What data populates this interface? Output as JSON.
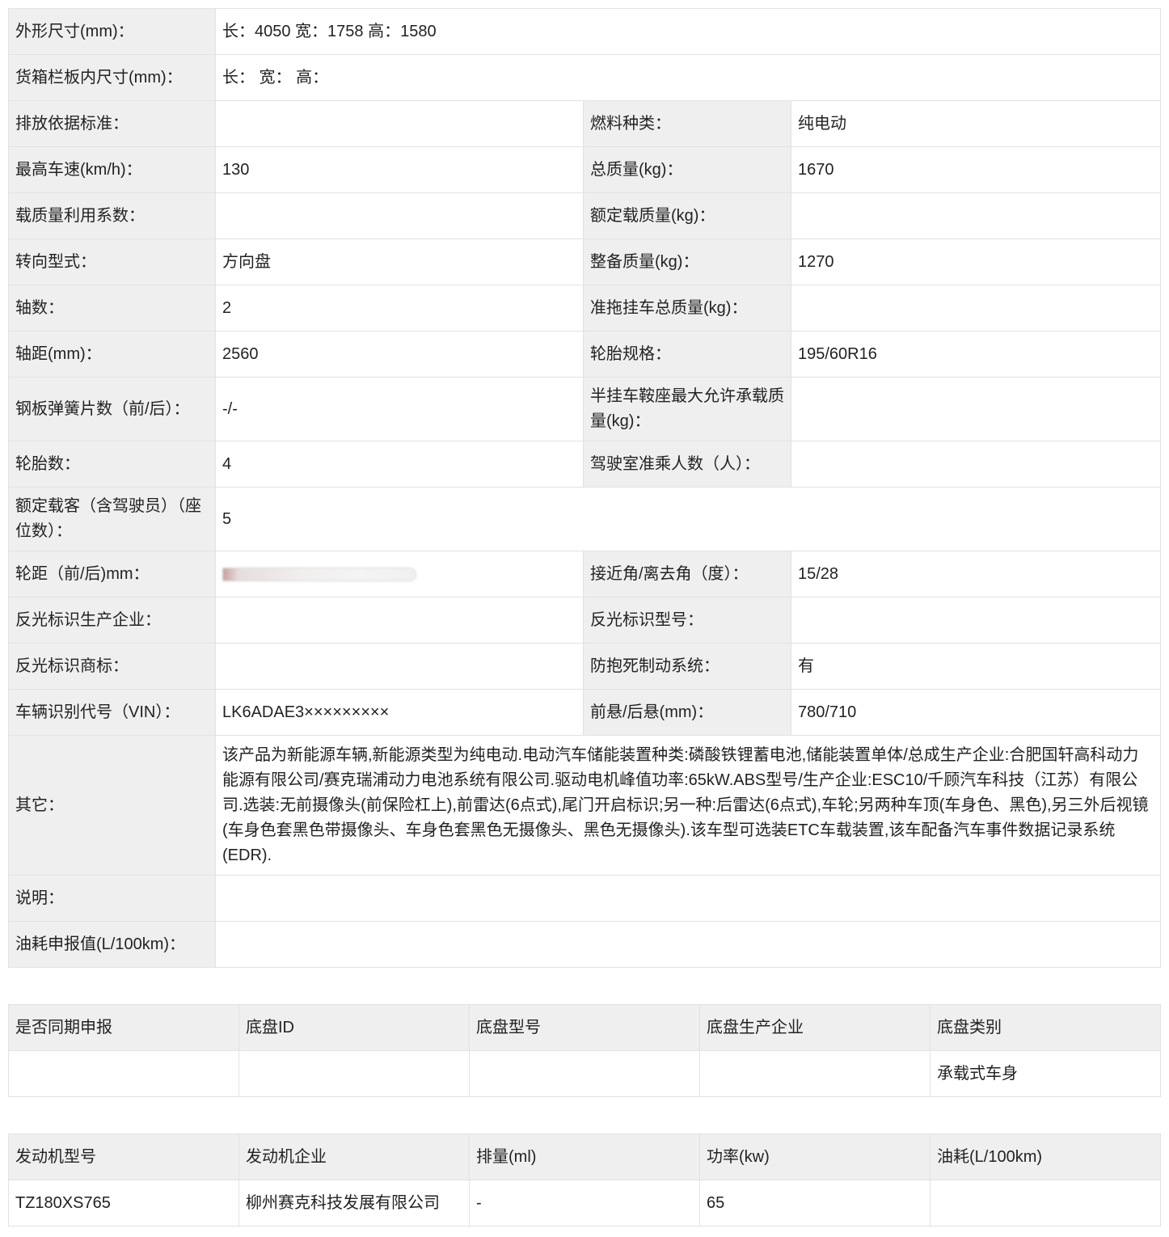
{
  "spec": {
    "dimensions_label": "外形尺寸(mm)：",
    "dimensions_value": "长：4050 宽：1758 高：1580",
    "cargo_box_label": "货箱栏板内尺寸(mm)：",
    "cargo_box_value": "长：  宽：  高：",
    "emission_label": "排放依据标准：",
    "emission_value": "",
    "fuel_label": "燃料种类：",
    "fuel_value": "纯电动",
    "max_speed_label": "最高车速(km/h)：",
    "max_speed_value": "130",
    "total_mass_label": "总质量(kg)：",
    "total_mass_value": "1670",
    "load_util_label": "载质量利用系数：",
    "load_util_value": "",
    "rated_load_label": "额定载质量(kg)：",
    "rated_load_value": "",
    "steering_label": "转向型式：",
    "steering_value": "方向盘",
    "curb_mass_label": "整备质量(kg)：",
    "curb_mass_value": "1270",
    "axles_label": "轴数：",
    "axles_value": "2",
    "trailer_mass_label": "准拖挂车总质量(kg)：",
    "trailer_mass_value": "",
    "wheelbase_label": "轴距(mm)：",
    "wheelbase_value": "2560",
    "tire_spec_label": "轮胎规格：",
    "tire_spec_value": "195/60R16",
    "leaf_spring_label": "钢板弹簧片数（前/后）：",
    "leaf_spring_value": "-/-",
    "saddle_label": "半挂车鞍座最大允许承载质量(kg)：",
    "saddle_value": "",
    "tires_count_label": "轮胎数：",
    "tires_count_value": "4",
    "cab_seats_label": "驾驶室准乘人数（人）：",
    "cab_seats_value": "",
    "passengers_label": "额定载客（含驾驶员）（座位数）：",
    "passengers_value": "5",
    "track_label": "轮距（前/后)mm：",
    "approach_label": "接近角/离去角（度）：",
    "approach_value": "15/28",
    "reflector_maker_label": "反光标识生产企业：",
    "reflector_maker_value": "",
    "reflector_model_label": "反光标识型号：",
    "reflector_model_value": "",
    "reflector_brand_label": "反光标识商标：",
    "reflector_brand_value": "",
    "abs_label": "防抱死制动系统：",
    "abs_value": "有",
    "vin_label": "车辆识别代号（VIN）：",
    "vin_value": "LK6ADAE3×××××××××",
    "overhang_label": "前悬/后悬(mm)：",
    "overhang_value": "780/710",
    "other_label": "其它：",
    "other_value": "该产品为新能源车辆,新能源类型为纯电动.电动汽车储能装置种类:磷酸铁锂蓄电池,储能装置单体/总成生产企业:合肥国轩高科动力能源有限公司/赛克瑞浦动力电池系统有限公司.驱动电机峰值功率:65kW.ABS型号/生产企业:ESC10/千顾汽车科技（江苏）有限公司.选装:无前摄像头(前保险杠上),前雷达(6点式),尾门开启标识;另一种:后雷达(6点式),车轮;另两种车顶(车身色、黑色),另三外后视镜(车身色套黑色带摄像头、车身色套黑色无摄像头、黑色无摄像头).该车型可选装ETC车载装置,该车配备汽车事件数据记录系统(EDR).",
    "note_label": "说明：",
    "note_value": "",
    "fuel_consumption_label": "油耗申报值(L/100km)：",
    "fuel_consumption_value": ""
  },
  "chassis": {
    "headers": [
      "是否同期申报",
      "底盘ID",
      "底盘型号",
      "底盘生产企业",
      "底盘类别"
    ],
    "row": [
      "",
      "",
      "",
      "",
      "承载式车身"
    ]
  },
  "engine": {
    "headers": [
      "发动机型号",
      "发动机企业",
      "排量(ml)",
      "功率(kw)",
      "油耗(L/100km)"
    ],
    "row": [
      "TZ180XS765",
      "柳州赛克科技发展有限公司",
      "-",
      "65",
      ""
    ]
  },
  "colors": {
    "label_background": "#efefef",
    "value_background": "#ffffff",
    "border": "#e2e2e2",
    "text": "#222222"
  }
}
